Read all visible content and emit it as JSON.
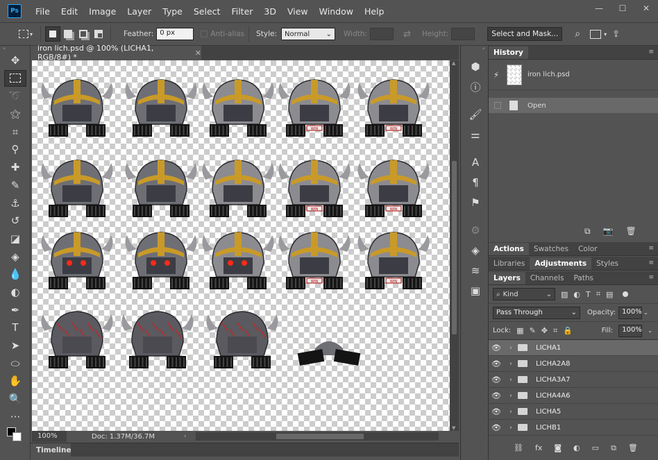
{
  "app": {
    "logo": "Ps"
  },
  "menu": [
    "File",
    "Edit",
    "Image",
    "Layer",
    "Type",
    "Select",
    "Filter",
    "3D",
    "View",
    "Window",
    "Help"
  ],
  "window_controls": {
    "minimize": "—",
    "maximize": "☐",
    "close": "✕"
  },
  "options": {
    "feather_label": "Feather:",
    "feather_value": "0 px",
    "antialias_label": "Anti-alias",
    "style_label": "Style:",
    "style_value": "Normal",
    "width_label": "Width:",
    "height_label": "Height:",
    "select_mask": "Select and Mask..."
  },
  "document": {
    "tab_title": "iron lich.psd @ 100% (LICHA1, RGB/8#) *",
    "zoom": "100%",
    "doc_size": "Doc: 1.37M/36.7M"
  },
  "timeline": {
    "label": "Timeline"
  },
  "history": {
    "tab": "History",
    "snapshot_name": "iron lich.psd",
    "steps": [
      "Open"
    ]
  },
  "panel_tabs_1": [
    "Actions",
    "Swatches",
    "Color"
  ],
  "panel_tabs_2": [
    "Libraries",
    "Adjustments",
    "Styles"
  ],
  "panel_tabs_3": [
    "Layers",
    "Channels",
    "Paths"
  ],
  "layers": {
    "filter_kind": "Kind",
    "blend_mode": "Pass Through",
    "opacity_label": "Opacity:",
    "opacity_value": "100%",
    "lock_label": "Lock:",
    "fill_label": "Fill:",
    "fill_value": "100%",
    "items": [
      {
        "name": "LICHA1"
      },
      {
        "name": "LICHA2A8"
      },
      {
        "name": "LICHA3A7"
      },
      {
        "name": "LICHA4A6"
      },
      {
        "name": "LICHA5"
      },
      {
        "name": "LICHB1"
      }
    ]
  },
  "sprite_label": "WIN"
}
